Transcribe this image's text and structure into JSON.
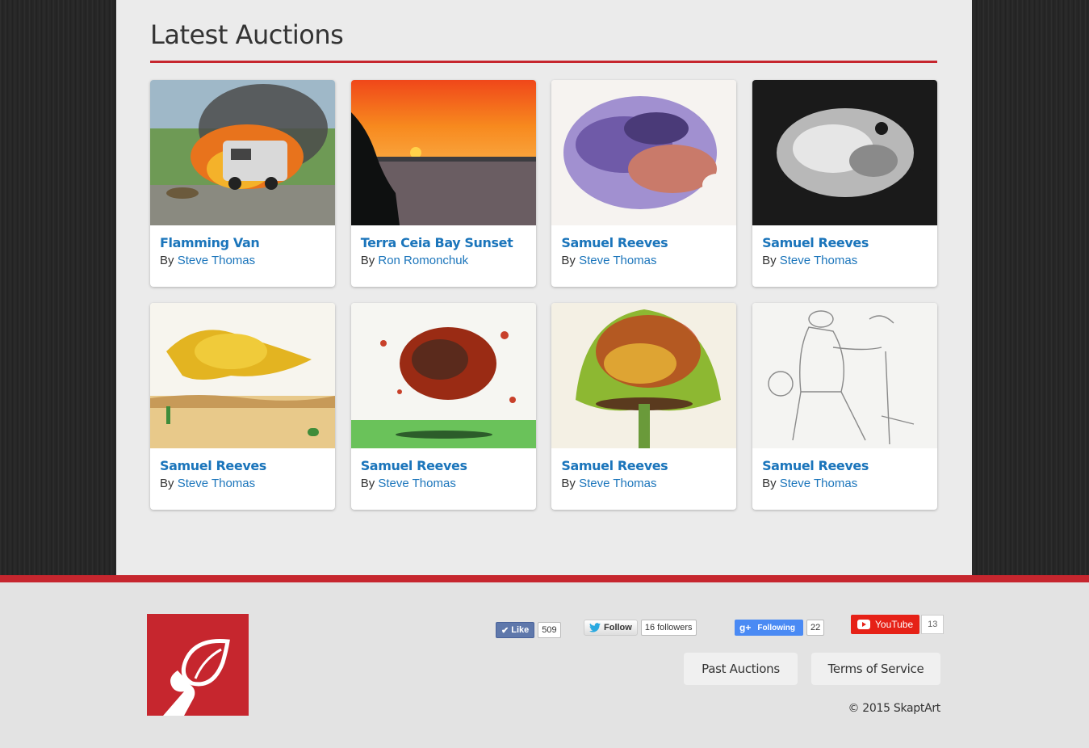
{
  "colors": {
    "accent": "#c6262e",
    "link": "#1b75bb",
    "panel": "#ebebeb"
  },
  "section": {
    "title": "Latest Auctions"
  },
  "by_label": "By",
  "cards": [
    {
      "title": "Flamming Van",
      "author": "Steve Thomas",
      "image": "burning-van-painting"
    },
    {
      "title": "Terra Ceia Bay Sunset",
      "author": "Ron Romonchuk",
      "image": "sunset-bay-photo"
    },
    {
      "title": "Samuel Reeves",
      "author": "Steve Thomas",
      "image": "purple-watercolor-cloud"
    },
    {
      "title": "Samuel Reeves",
      "author": "Steve Thomas",
      "image": "black-ink-cloud"
    },
    {
      "title": "Samuel Reeves",
      "author": "Steve Thomas",
      "image": "yellow-cloud-desert"
    },
    {
      "title": "Samuel Reeves",
      "author": "Steve Thomas",
      "image": "red-splatter-cloud"
    },
    {
      "title": "Samuel Reeves",
      "author": "Steve Thomas",
      "image": "tree-watercolor"
    },
    {
      "title": "Samuel Reeves",
      "author": "Steve Thomas",
      "image": "pencil-sketch-man"
    }
  ],
  "footer": {
    "social": {
      "facebook": {
        "label": "Like",
        "count": "509",
        "icon": "check-icon"
      },
      "twitter": {
        "label": "Follow",
        "count": "16 followers",
        "icon": "twitter-bird-icon"
      },
      "google": {
        "label": "Following",
        "count": "22",
        "icon": "google-plus-icon"
      },
      "youtube": {
        "label": "YouTube",
        "count": "13",
        "icon": "youtube-play-icon"
      }
    },
    "links": {
      "past": "Past Auctions",
      "terms": "Terms of Service"
    },
    "copyright": "© 2015 SkaptArt"
  }
}
